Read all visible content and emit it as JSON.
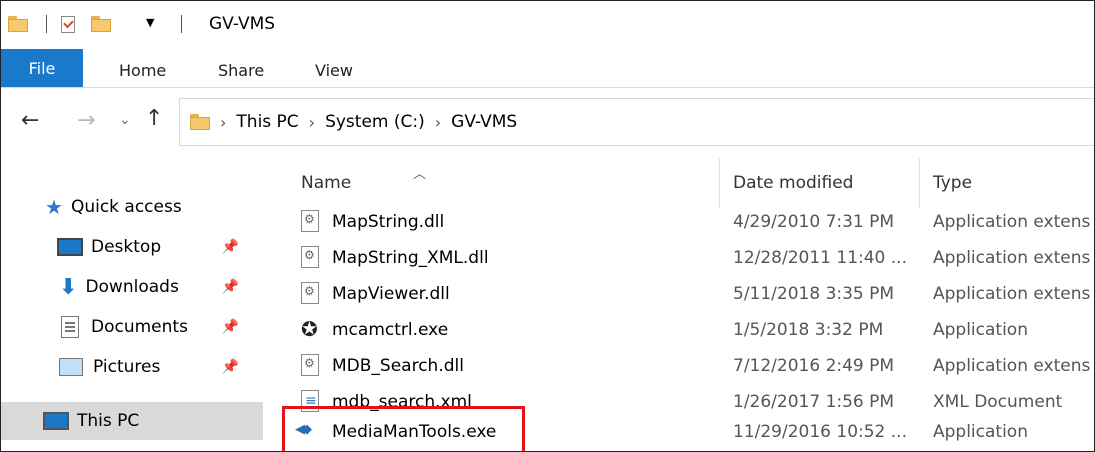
{
  "window": {
    "title": "GV-VMS"
  },
  "ribbon": {
    "tabs": [
      "File",
      "Home",
      "Share",
      "View"
    ]
  },
  "address": {
    "crumbs": [
      "This PC",
      "System (C:)",
      "GV-VMS"
    ]
  },
  "nav": {
    "quick_access": "Quick access",
    "items": [
      {
        "label": "Desktop",
        "icon": "desktop-icon",
        "pinned": true
      },
      {
        "label": "Downloads",
        "icon": "downloads-icon",
        "pinned": true
      },
      {
        "label": "Documents",
        "icon": "documents-icon",
        "pinned": true
      },
      {
        "label": "Pictures",
        "icon": "pictures-icon",
        "pinned": true
      }
    ],
    "this_pc": "This PC"
  },
  "columns": {
    "name": "Name",
    "date": "Date modified",
    "type": "Type"
  },
  "files": [
    {
      "name": "MapString.dll",
      "date": "4/29/2010 7:31 PM",
      "type": "Application extens",
      "icon": "dll-icon"
    },
    {
      "name": "MapString_XML.dll",
      "date": "12/28/2011 11:40 ...",
      "type": "Application extens",
      "icon": "dll-icon"
    },
    {
      "name": "MapViewer.dll",
      "date": "5/11/2018 3:35 PM",
      "type": "Application extens",
      "icon": "dll-icon"
    },
    {
      "name": "mcamctrl.exe",
      "date": "1/5/2018 3:32 PM",
      "type": "Application",
      "icon": "exe-icon"
    },
    {
      "name": "MDB_Search.dll",
      "date": "7/12/2016 2:49 PM",
      "type": "Application extens",
      "icon": "dll-icon"
    },
    {
      "name": "mdb_search.xml",
      "date": "1/26/2017 1:56 PM",
      "type": "XML Document",
      "icon": "xml-icon"
    },
    {
      "name": "MediaManTools.exe",
      "date": "11/29/2016 10:52 ...",
      "type": "Application",
      "icon": "media-exe-icon",
      "highlighted": true
    }
  ],
  "colors": {
    "file_tab": "#1979ca",
    "highlight_box": "#e0141b",
    "selected_nav": "#d9d9d9"
  }
}
